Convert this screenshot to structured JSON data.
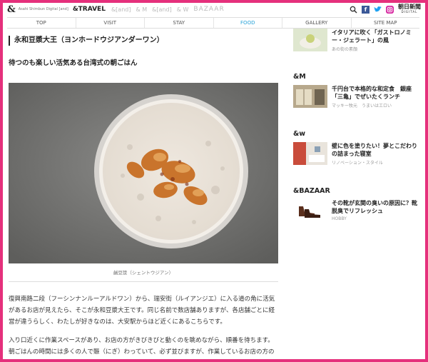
{
  "header": {
    "logo": "&",
    "logo_sub": "Asahi Shimbun Digital [and]",
    "travel": "&TRAVEL",
    "brands": [
      "&[and]",
      "& M",
      "&[and]",
      "& W"
    ],
    "bazaar": "BAZAAR",
    "icons": [
      "search-icon",
      "facebook-icon",
      "twitter-icon",
      "instagram-icon"
    ],
    "asahi_main": "朝日新聞",
    "asahi_sub": "DIGITAL"
  },
  "nav": {
    "items": [
      "TOP",
      "VISIT",
      "STAY",
      "FOOD",
      "GALLERY",
      "SITE MAP"
    ],
    "active": "FOOD"
  },
  "article": {
    "shop_title": "永和豆漿大王（ヨンホードウジアンダーワン）",
    "subtitle": "待つのも楽しい活気ある台湾式の朝ごはん",
    "photo_caption": "鹹豆漿（シェントウジアン）",
    "para1": "復興南路二段（フーシンナンルーアルドワン）から、瑞安街（ルイアンジエ）に入る道の角に活気があるお店が見えたら、そこが永和豆漿大王です。同じ名前で数店舗ありますが、各店舗ごとに経営が違うらしく、わたしが好きなのは、大安駅からほど近くにあるこちらです。",
    "para2": "入り口近くに作業スペースがあり、お店の方がきびきびと動くのを眺めながら、順番を待ちます。朝ごはんの時間には多くの人で賑（にぎ）わっていて、必ず並びますが、作業しているお店の方の姿が見えるので、待つのも楽しいものです。タイル"
  },
  "sidebar": {
    "top": {
      "title": "イタリアに吹く「ガストロノミー・ジェラート」の風",
      "meta": "あの街の素顔"
    },
    "m": {
      "label": "&M",
      "title": "千円台で本格的な和定食　銀座「三亀」でぜいたくランチ",
      "meta": "マッキー牧元　うまいはエロい"
    },
    "w": {
      "label": "&w",
      "title": "壁に色を塗りたい！夢とこだわりの詰まった寝室",
      "meta": "リノベーション・スタイル"
    },
    "bazaar": {
      "label": "&BAZAAR",
      "title": "その靴が玄関の臭いの原因に？靴脱臭でリフレッシュ",
      "meta": "HOBBY"
    }
  },
  "colors": {
    "frame": "#e5307c",
    "nav_active": "#2aa3d8"
  }
}
